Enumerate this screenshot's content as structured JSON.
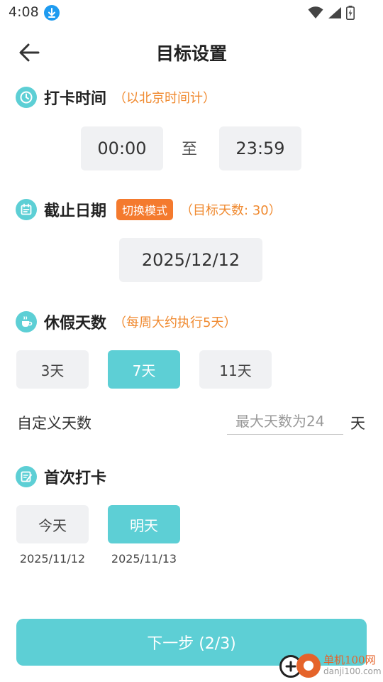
{
  "status": {
    "time": "4:08"
  },
  "header": {
    "title": "目标设置"
  },
  "checkin": {
    "title": "打卡时间",
    "note": "（以北京时间计）",
    "start": "00:00",
    "to": "至",
    "end": "23:59"
  },
  "deadline": {
    "title": "截止日期",
    "mode_button": "切换模式",
    "note": "（目标天数: 30）",
    "date": "2025/12/12"
  },
  "vacation": {
    "title": "休假天数",
    "note": "（每周大约执行5天）",
    "options": [
      {
        "label": "3天",
        "selected": false
      },
      {
        "label": "7天",
        "selected": true
      },
      {
        "label": "11天",
        "selected": false
      }
    ],
    "custom_label": "自定义天数",
    "custom_placeholder": "最大天数为24",
    "custom_unit": "天"
  },
  "first": {
    "title": "首次打卡",
    "options": [
      {
        "label": "今天",
        "date": "2025/11/12",
        "selected": false
      },
      {
        "label": "明天",
        "date": "2025/11/13",
        "selected": true
      }
    ]
  },
  "footer": {
    "next_label": "下一步 (2/3)"
  },
  "watermark": {
    "name": "单机100网",
    "url": "danji100.com"
  },
  "colors": {
    "accent": "#5dcfd5",
    "orange": "#f08a30",
    "mode_button": "#f47a2e",
    "chip_bg": "#f0f1f3"
  }
}
